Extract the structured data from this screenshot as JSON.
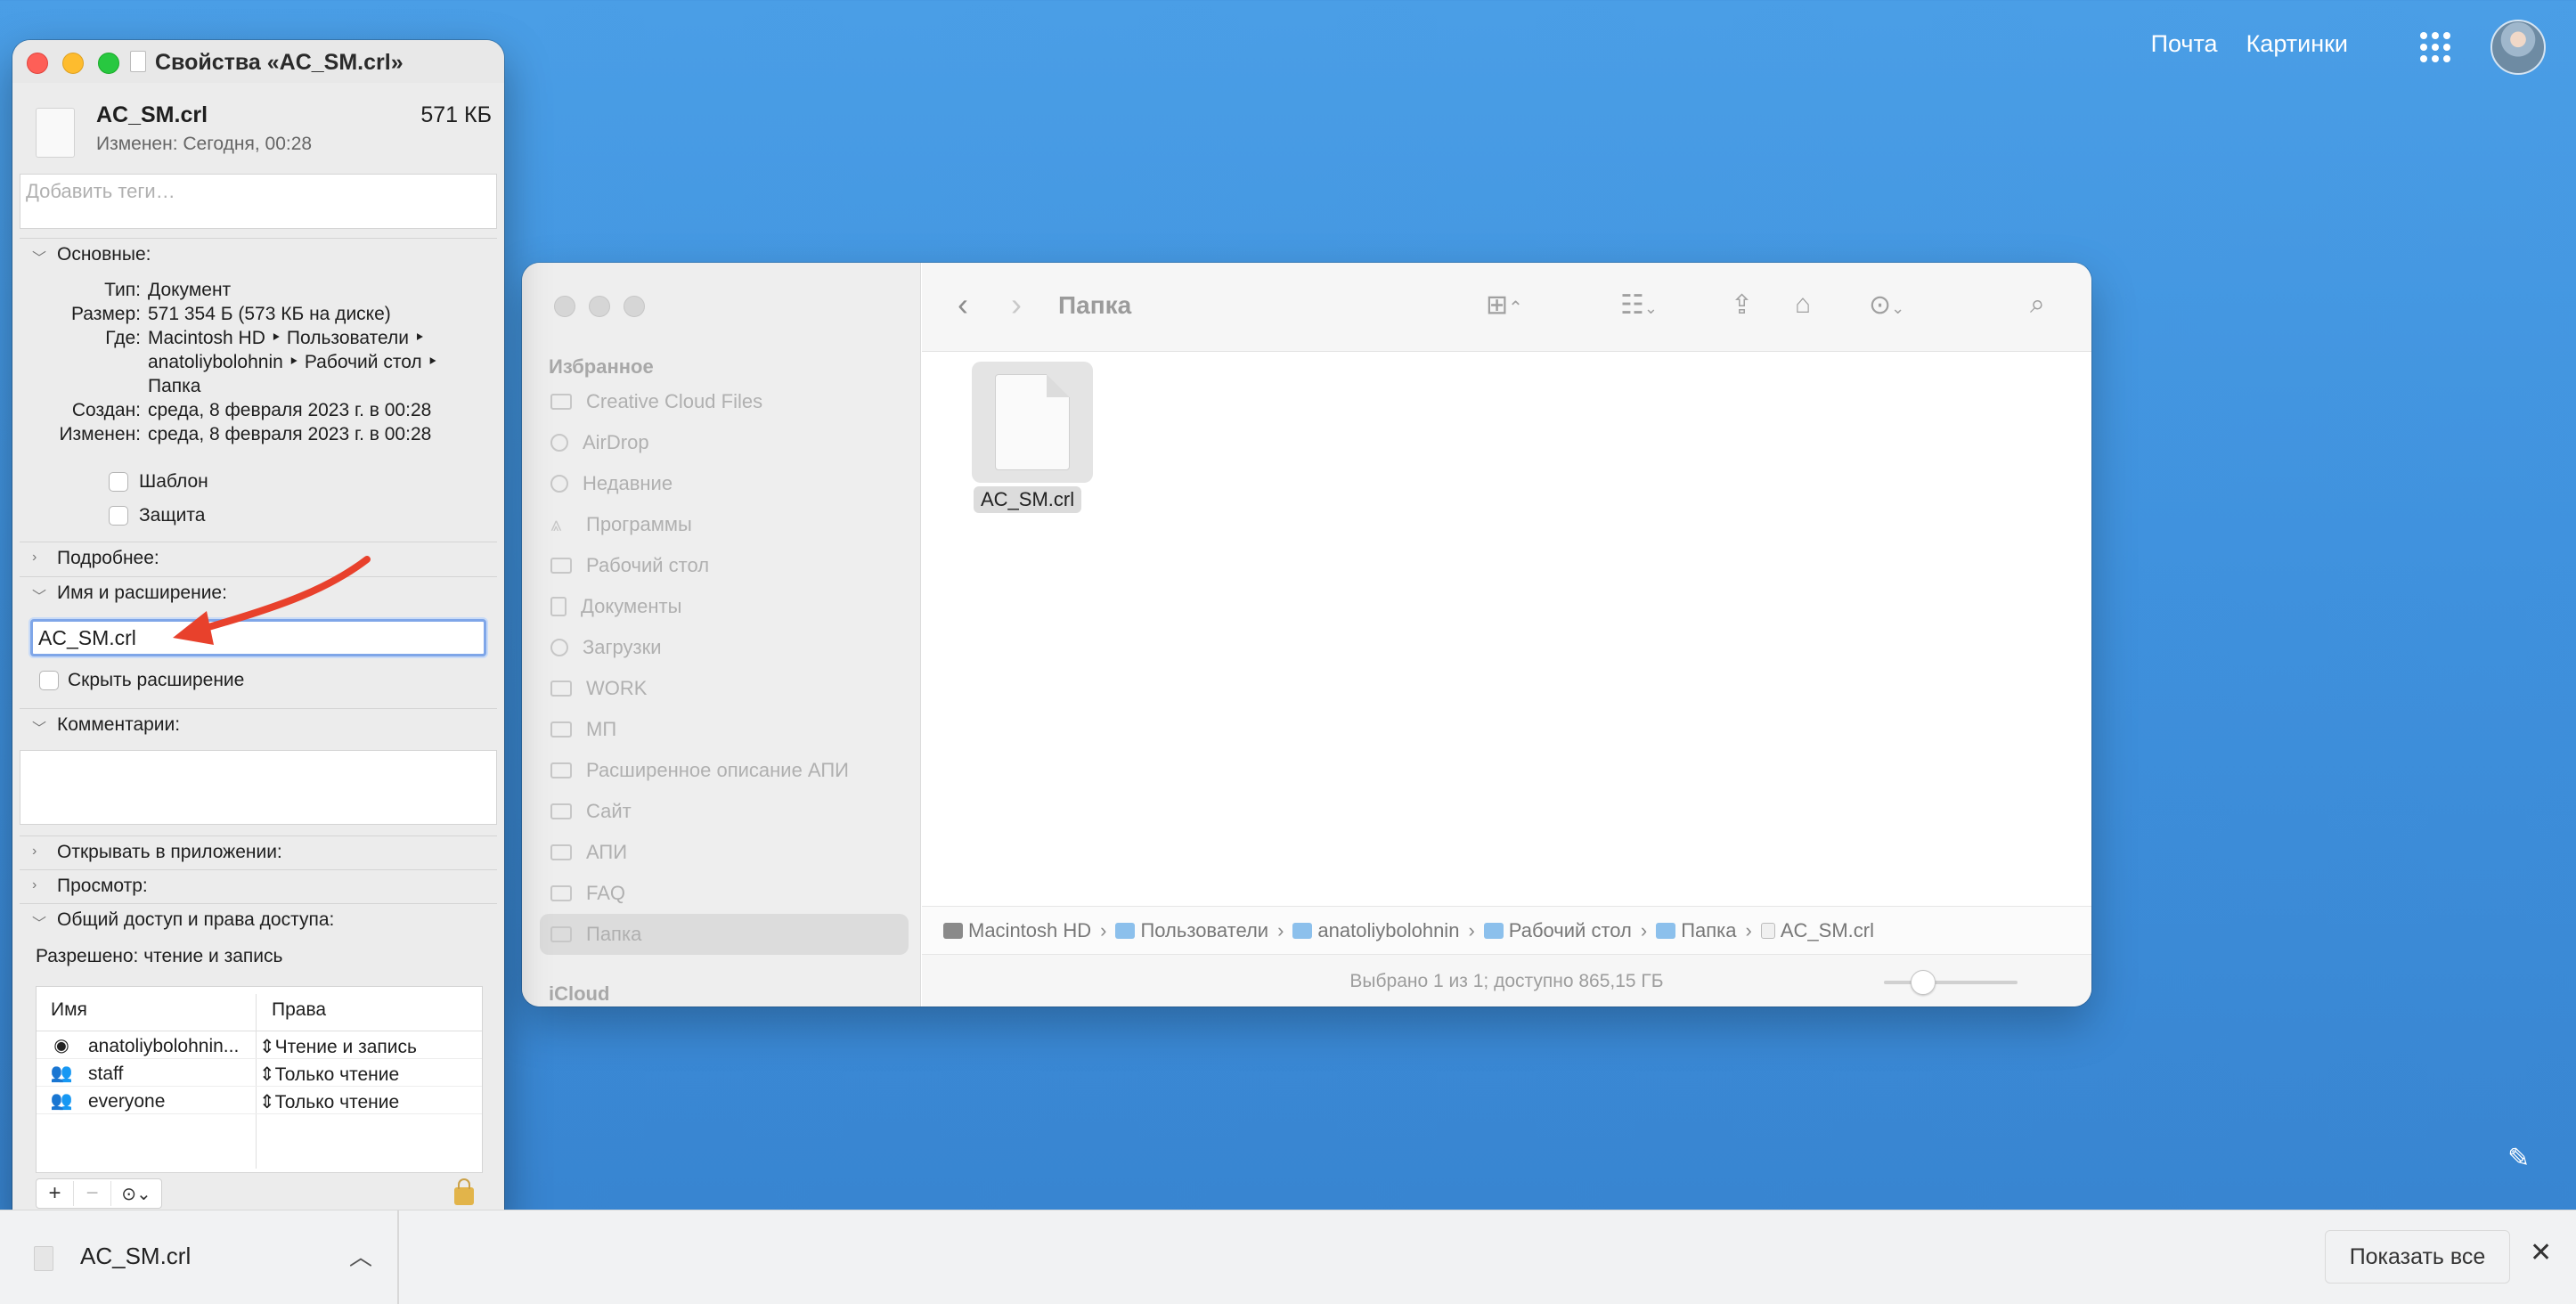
{
  "browser": {
    "links": [
      "Почта",
      "Картинки"
    ]
  },
  "finder": {
    "title": "Папка",
    "sidebar": {
      "section_favorites": "Избранное",
      "items": [
        {
          "label": "Creative Cloud Files",
          "icon": "folder-icon"
        },
        {
          "label": "AirDrop",
          "icon": "airdrop-icon"
        },
        {
          "label": "Недавние",
          "icon": "clock-icon"
        },
        {
          "label": "Программы",
          "icon": "apps-icon"
        },
        {
          "label": "Рабочий стол",
          "icon": "desktop-icon"
        },
        {
          "label": "Документы",
          "icon": "document-icon"
        },
        {
          "label": "Загрузки",
          "icon": "download-icon"
        },
        {
          "label": "WORK",
          "icon": "folder-icon"
        },
        {
          "label": "МП",
          "icon": "folder-icon"
        },
        {
          "label": "Расширенное описание АПИ",
          "icon": "folder-icon"
        },
        {
          "label": "Сайт",
          "icon": "folder-icon"
        },
        {
          "label": "АПИ",
          "icon": "folder-icon"
        },
        {
          "label": "FAQ",
          "icon": "folder-icon"
        },
        {
          "label": "Папка",
          "icon": "folder-icon",
          "selected": true
        }
      ],
      "section_icloud": "iCloud"
    },
    "file": {
      "name": "AC_SM.crl"
    },
    "path": [
      "Macintosh HD",
      "Пользователи",
      "anatoliybolohnin",
      "Рабочий стол",
      "Папка",
      "AC_SM.crl"
    ],
    "status": "Выбрано 1 из 1; доступно 865,15 ГБ",
    "icon_zoom": 0.2
  },
  "info": {
    "title": "Свойства «AC_SM.crl»",
    "name": "AC_SM.crl",
    "size": "571 КБ",
    "modified": "Изменен: Сегодня, 00:28",
    "tags_placeholder": "Добавить теги…",
    "general": {
      "label": "Основные:",
      "type_key": "Тип:",
      "type_val": "Документ",
      "size_key": "Размер:",
      "size_val": "571 354 Б (573 КБ на диске)",
      "where_key": "Где:",
      "where_line1": "Macintosh HD ‣ Пользователи ‣",
      "where_line2": "anatoliybolohnin ‣ Рабочий стол ‣",
      "where_line3": "Папка",
      "created_key": "Создан:",
      "created_val": "среда, 8 февраля 2023 г. в 00:28",
      "modified_key": "Изменен:",
      "modified_val": "среда, 8 февраля 2023 г. в 00:28",
      "template_label": "Шаблон",
      "locked_label": "Защита"
    },
    "more_info": "Подробнее:",
    "name_ext": {
      "label": "Имя и расширение:",
      "value": "AC_SM.crl",
      "hide_ext": "Скрыть расширение"
    },
    "comments": "Комментарии:",
    "open_with": "Открывать в приложении:",
    "preview": "Просмотр:",
    "sharing": {
      "label": "Общий доступ и права доступа:",
      "allowed": "Разрешено: чтение и запись",
      "col_name": "Имя",
      "col_rights": "Права",
      "rows": [
        {
          "name": "anatoliybolohnin...",
          "rights": "Чтение и запись",
          "icon": "user-icon"
        },
        {
          "name": "staff",
          "rights": "Только чтение",
          "icon": "group-icon"
        },
        {
          "name": "everyone",
          "rights": "Только чтение",
          "icon": "everyone-icon"
        }
      ]
    }
  },
  "downloads": {
    "file": "AC_SM.crl",
    "show_all": "Показать все"
  }
}
